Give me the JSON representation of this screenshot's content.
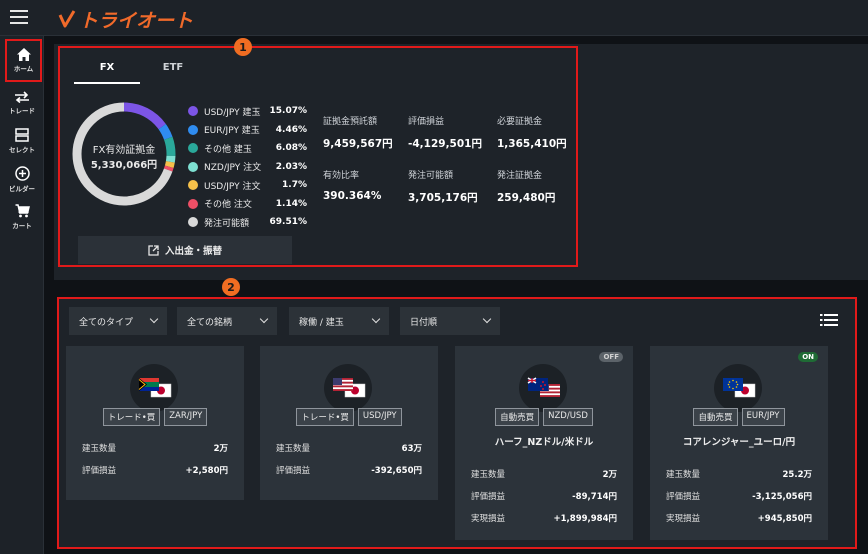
{
  "app": {
    "logo_text": "トライオート"
  },
  "sidebar": {
    "items": [
      {
        "label": "ホーム",
        "icon": "home-icon"
      },
      {
        "label": "トレード",
        "icon": "trade-icon"
      },
      {
        "label": "セレクト",
        "icon": "select-icon"
      },
      {
        "label": "ビルダー",
        "icon": "builder-icon"
      },
      {
        "label": "カート",
        "icon": "cart-icon"
      }
    ]
  },
  "markers": {
    "one": "1",
    "two": "2"
  },
  "summary": {
    "tabs": [
      "FX",
      "ETF"
    ],
    "active_tab": "FX",
    "donut": {
      "title": "FX有効証拠金",
      "value": "5,330,066円"
    },
    "legend": [
      {
        "label": "USD/JPY 建玉",
        "pct": "15.07%",
        "color": "#7c55e6",
        "value": 15.07
      },
      {
        "label": "EUR/JPY 建玉",
        "pct": "4.46%",
        "color": "#2f8cf0",
        "value": 4.46
      },
      {
        "label": "その他 建玉",
        "pct": "6.08%",
        "color": "#2aa89a",
        "value": 6.08
      },
      {
        "label": "NZD/JPY 注文",
        "pct": "2.03%",
        "color": "#7ee0d2",
        "value": 2.03
      },
      {
        "label": "USD/JPY 注文",
        "pct": "1.7%",
        "color": "#f5c04a",
        "value": 1.7
      },
      {
        "label": "その他 注文",
        "pct": "1.14%",
        "color": "#ef4f66",
        "value": 1.14
      },
      {
        "label": "発注可能額",
        "pct": "69.51%",
        "color": "#d9d9d9",
        "value": 69.51
      }
    ],
    "metrics": [
      {
        "label": "証拠金預託額",
        "value": "9,459,567円"
      },
      {
        "label": "評価損益",
        "value": "-4,129,501円"
      },
      {
        "label": "必要証拠金",
        "value": "1,365,410円"
      },
      {
        "label": "有効比率",
        "value": "390.364%"
      },
      {
        "label": "発注可能額",
        "value": "3,705,176円"
      },
      {
        "label": "発注証拠金",
        "value": "259,480円"
      }
    ],
    "deposit_button": "入出金・振替"
  },
  "filters": {
    "type": "全てのタイプ",
    "symbol": "全ての銘柄",
    "status": "稼働 / 建玉",
    "sort": "日付順"
  },
  "cards": [
    {
      "flag": "ZAR",
      "tags": [
        "トレード•買",
        "ZAR/JPY"
      ],
      "strategy": "",
      "rows": [
        {
          "label": "建玉数量",
          "value": "2万"
        },
        {
          "label": "評価損益",
          "value": "+2,580円"
        }
      ]
    },
    {
      "flag": "USD",
      "tags": [
        "トレード•買",
        "USD/JPY"
      ],
      "strategy": "",
      "rows": [
        {
          "label": "建玉数量",
          "value": "63万"
        },
        {
          "label": "評価損益",
          "value": "-392,650円"
        }
      ]
    },
    {
      "flag": "NZD",
      "badge": "OFF",
      "tags": [
        "自動売買",
        "NZD/USD"
      ],
      "strategy": "ハーフ_NZドル/米ドル",
      "rows": [
        {
          "label": "建玉数量",
          "value": "2万"
        },
        {
          "label": "評価損益",
          "value": "-89,714円"
        },
        {
          "label": "実現損益",
          "value": "+1,899,984円"
        }
      ]
    },
    {
      "flag": "EUR",
      "badge": "ON",
      "tags": [
        "自動売買",
        "EUR/JPY"
      ],
      "strategy": "コアレンジャー_ユーロ/円",
      "rows": [
        {
          "label": "建玉数量",
          "value": "25.2万"
        },
        {
          "label": "評価損益",
          "value": "-3,125,056円"
        },
        {
          "label": "実現損益",
          "value": "+945,850円"
        }
      ]
    }
  ],
  "colors": {
    "accent": "#f16a2a",
    "highlight": "#e11a1a"
  }
}
